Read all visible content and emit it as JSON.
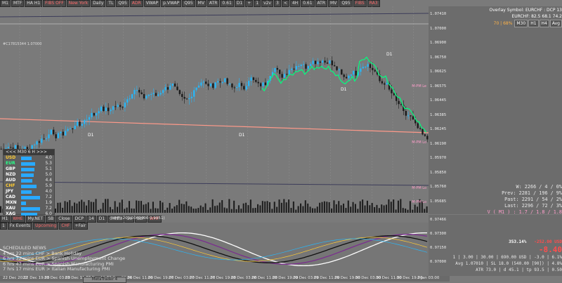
{
  "toolbar": {
    "left_items": [
      "M1",
      "MTF",
      "HA H1",
      "FIBS OFF",
      "New York",
      "Daily",
      "TL",
      "Q95",
      "ADR",
      "VWAP",
      "p.VWAP",
      "Q95",
      "MV",
      "ATR",
      "0.61",
      "D1",
      "+",
      "1",
      "v2v",
      "3",
      "<",
      "4H",
      "0.61",
      "ATR",
      "MV",
      "Q95",
      "FIBS",
      "RA3"
    ],
    "symbol_info": [
      "EURCHF,M30",
      "M 4 H",
      "D",
      "Weekly",
      "Monthly",
      "Hbd",
      "Upm",
      "1.0",
      "66",
      "76",
      "15",
      "16",
      "53"
    ]
  },
  "overlay": {
    "symbol_line": "Overlay Symbol: EURCHF : DCP 13",
    "pair_line": "EURCHF: 82.5 68.1 74.2",
    "pct_line_value": "70 | 68%",
    "tags": [
      "M30",
      "H1",
      "H4",
      "Avg"
    ]
  },
  "price_axis": [
    "1.07410",
    "1.07000",
    "1.06900",
    "1.06750",
    "1.06625",
    "1.06575",
    "1.06445",
    "1.06385",
    "1.06245",
    "1.06190",
    "1.05970",
    "1.05850",
    "1.05760",
    "1.05685"
  ],
  "chart_labels": {
    "left_top": "#C17815344 1.07000",
    "left_mid": "#C17815344 1.07000",
    "levels": [
      "D1",
      "D1",
      "D1",
      "D1",
      "D1"
    ],
    "right_tags": [
      "M-PM Le",
      "M-PM Lo",
      "M-PM Lo",
      "M-PM Lo"
    ],
    "cyc": "CYC"
  },
  "currency_panel": {
    "header": "<<<   M30  6  H   >>>",
    "rows": [
      {
        "name": "USD",
        "val": "4.0",
        "color": "#ffcc33"
      },
      {
        "name": "EUR",
        "val": "5.3",
        "color": "#29ff8a"
      },
      {
        "name": "GBP",
        "val": "5.1",
        "color": "#ffffff"
      },
      {
        "name": "NZD",
        "val": "5.0",
        "color": "#ffffff"
      },
      {
        "name": "AUD",
        "val": "4.4",
        "color": "#ffffff"
      },
      {
        "name": "CHF",
        "val": "5.9",
        "color": "#ffcc33"
      },
      {
        "name": "JPY",
        "val": "4.0",
        "color": "#ffffff"
      },
      {
        "name": "CAD",
        "val": "7.2",
        "color": "#ffffff"
      },
      {
        "name": "MXN",
        "val": "1.9",
        "color": "#ffffff"
      },
      {
        "name": "XAU",
        "val": "7.2",
        "color": "#ffffff"
      },
      {
        "name": "XAG",
        "val": "6.0",
        "color": "#ffffff"
      }
    ],
    "bar_levels": [
      0.55,
      0.72,
      0.68,
      0.66,
      0.58,
      0.8,
      0.55,
      0.96,
      0.26,
      0.96,
      0.82
    ]
  },
  "stats": {
    "w_line": "W: 2266 / 4 / 0%",
    "prev_line": "Prev: 2281 / 196 / 9%",
    "past_line": "Past: 2291 / 54 / 2%",
    "last_line": "Last: 2296 / 72 / 3%",
    "v_line": "V ( M1 ) : 1.7 / 1.8 / 1.8"
  },
  "bottom_toolbar": [
    "H1",
    "WHE",
    "My.NET",
    "SB",
    "Close",
    "DCP",
    "14",
    "D1",
    "0.618",
    "16",
    "SLP",
    "WHF"
  ],
  "bottom_toolbar2": [
    "1",
    "Fx Events",
    "Upcoming",
    "CHF",
    "+Fair"
  ],
  "osc_label": "WHF (200.0000000  0.9951)",
  "osc_axis": [
    "0.97466",
    "0.97300",
    "0.97150",
    "0.97000"
  ],
  "osc_stats": {
    "pct": "353.14%",
    "delta": "-252.00 USD",
    "big": "-8.40",
    "line1": "1 | 3.00 | 30.00 | 690.00 USD | -3.0 | 6.1%",
    "line2": "Avg 1.07010 | SL 18.0 (540.00 [90]) | 4.8%",
    "line3": "ATR 73.0 | d 45.1 | tp 93.5 | 0.50"
  },
  "scheduled": {
    "title": "SCHEDULED NEWS",
    "items": [
      "4 hrs 22 mins  CHF  >  Bank Holiday",
      "6 hrs 32 mins  EUR  >  Spanish Unemployment Change",
      "6 hrs 47 mins  EUR  >  Spanish Manufacturing PMI",
      "7 hrs 17 mins  EUR  >  Italian Manufacturing PMI"
    ]
  },
  "date_axis": [
    "22 Dec 2022",
    "22 Dec 19:00",
    "23 Dec 03:00",
    "23 Dec 11:00",
    "23 Dec 19:00",
    "26 Dec 03:00",
    "26 Dec 11:00",
    "26 Dec 19:00",
    "27 Dec 03:00",
    "27 Dec 11:00",
    "27 Dec 19:00",
    "28 Dec 03:00",
    "28 Dec 11:00",
    "28 Dec 19:00",
    "29 Dec 03:00",
    "29 Dec 11:00",
    "29 Dec 19:00",
    "30 Dec 03:00",
    "30 Dec 11:00",
    "30 Dec 19:00",
    "2 Jan 03:00"
  ],
  "tab_label": "MetaTrader 4",
  "colors": {
    "candle_up": "#29b6f6",
    "candle_down": "#1a1a1a",
    "accent_green": "#00ff7f",
    "accent_orange": "#ffa500",
    "pink": "#ff9ecb",
    "red": "#ff4d4d"
  }
}
